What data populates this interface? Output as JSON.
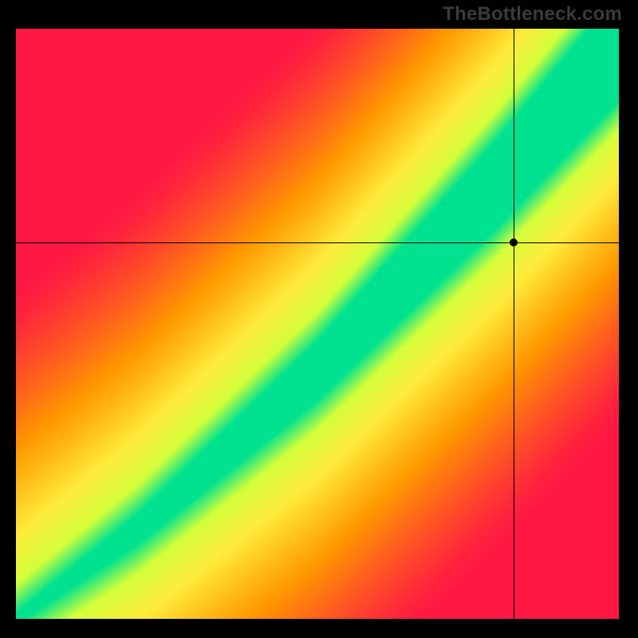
{
  "watermark": "TheBottleneck.com",
  "chart_data": {
    "type": "heatmap",
    "title": "",
    "xlabel": "",
    "ylabel": "",
    "xlim": [
      0,
      1
    ],
    "ylim": [
      0,
      1
    ],
    "grid": false,
    "legend": false,
    "color_stops": [
      {
        "t": 0.0,
        "hex": "#ff1744"
      },
      {
        "t": 0.4,
        "hex": "#ff9800"
      },
      {
        "t": 0.7,
        "hex": "#ffeb3b"
      },
      {
        "t": 0.88,
        "hex": "#d4ff3a"
      },
      {
        "t": 1.0,
        "hex": "#00e28f"
      }
    ],
    "optimal_curve": {
      "description": "slightly superlinear diagonal band where value peaks (green)",
      "control_points": [
        {
          "x": 0.0,
          "y": 0.0
        },
        {
          "x": 0.2,
          "y": 0.15
        },
        {
          "x": 0.5,
          "y": 0.42
        },
        {
          "x": 0.8,
          "y": 0.74
        },
        {
          "x": 1.0,
          "y": 0.97
        }
      ],
      "band_halfwidth_start": 0.008,
      "band_halfwidth_end": 0.09
    },
    "crosshair": {
      "x": 0.825,
      "y": 0.638
    },
    "marker": {
      "x": 0.825,
      "y": 0.638
    }
  }
}
